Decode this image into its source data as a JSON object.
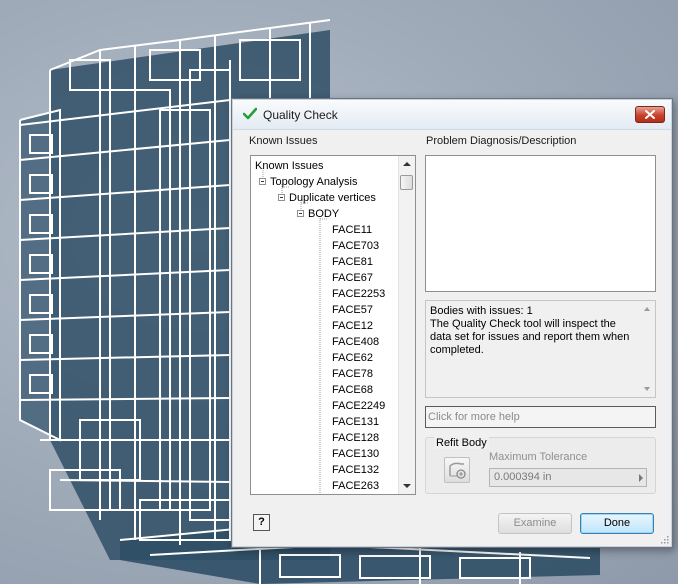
{
  "dialog": {
    "title": "Quality Check",
    "close_label": "✕"
  },
  "known_issues": {
    "header": "Known Issues",
    "tree": [
      {
        "label": "Known Issues",
        "level": 0,
        "expander": false
      },
      {
        "label": "Topology Analysis",
        "level": 1,
        "expander": true
      },
      {
        "label": "Duplicate vertices",
        "level": 2,
        "expander": true
      },
      {
        "label": "BODY",
        "level": 3,
        "expander": true
      },
      {
        "label": "FACE11",
        "level": 4,
        "expander": false
      },
      {
        "label": "FACE703",
        "level": 4,
        "expander": false
      },
      {
        "label": "FACE81",
        "level": 4,
        "expander": false
      },
      {
        "label": "FACE67",
        "level": 4,
        "expander": false
      },
      {
        "label": "FACE2253",
        "level": 4,
        "expander": false
      },
      {
        "label": "FACE57",
        "level": 4,
        "expander": false
      },
      {
        "label": "FACE12",
        "level": 4,
        "expander": false
      },
      {
        "label": "FACE408",
        "level": 4,
        "expander": false
      },
      {
        "label": "FACE62",
        "level": 4,
        "expander": false
      },
      {
        "label": "FACE78",
        "level": 4,
        "expander": false
      },
      {
        "label": "FACE68",
        "level": 4,
        "expander": false
      },
      {
        "label": "FACE2249",
        "level": 4,
        "expander": false
      },
      {
        "label": "FACE131",
        "level": 4,
        "expander": false
      },
      {
        "label": "FACE128",
        "level": 4,
        "expander": false
      },
      {
        "label": "FACE130",
        "level": 4,
        "expander": false
      },
      {
        "label": "FACE132",
        "level": 4,
        "expander": false
      },
      {
        "label": "FACE263",
        "level": 4,
        "expander": false
      }
    ]
  },
  "diagnosis": {
    "header": "Problem Diagnosis/Description",
    "text": ""
  },
  "status": {
    "line1": "Bodies with issues: 1",
    "line2": "The Quality Check tool will inspect the data set for issues and report them when completed."
  },
  "help_field": {
    "text": "Click for more help"
  },
  "refit": {
    "title": "Refit Body",
    "tolerance_label": "Maximum Tolerance",
    "tolerance_value": "0.000394 in"
  },
  "buttons": {
    "help": "?",
    "examine": "Examine",
    "done": "Done"
  },
  "colors": {
    "check_icon": "#2a9d3a",
    "close_button": "#c8422c",
    "wireframe_stroke": "#ffffff",
    "wireframe_fill": "#2f4f66"
  }
}
